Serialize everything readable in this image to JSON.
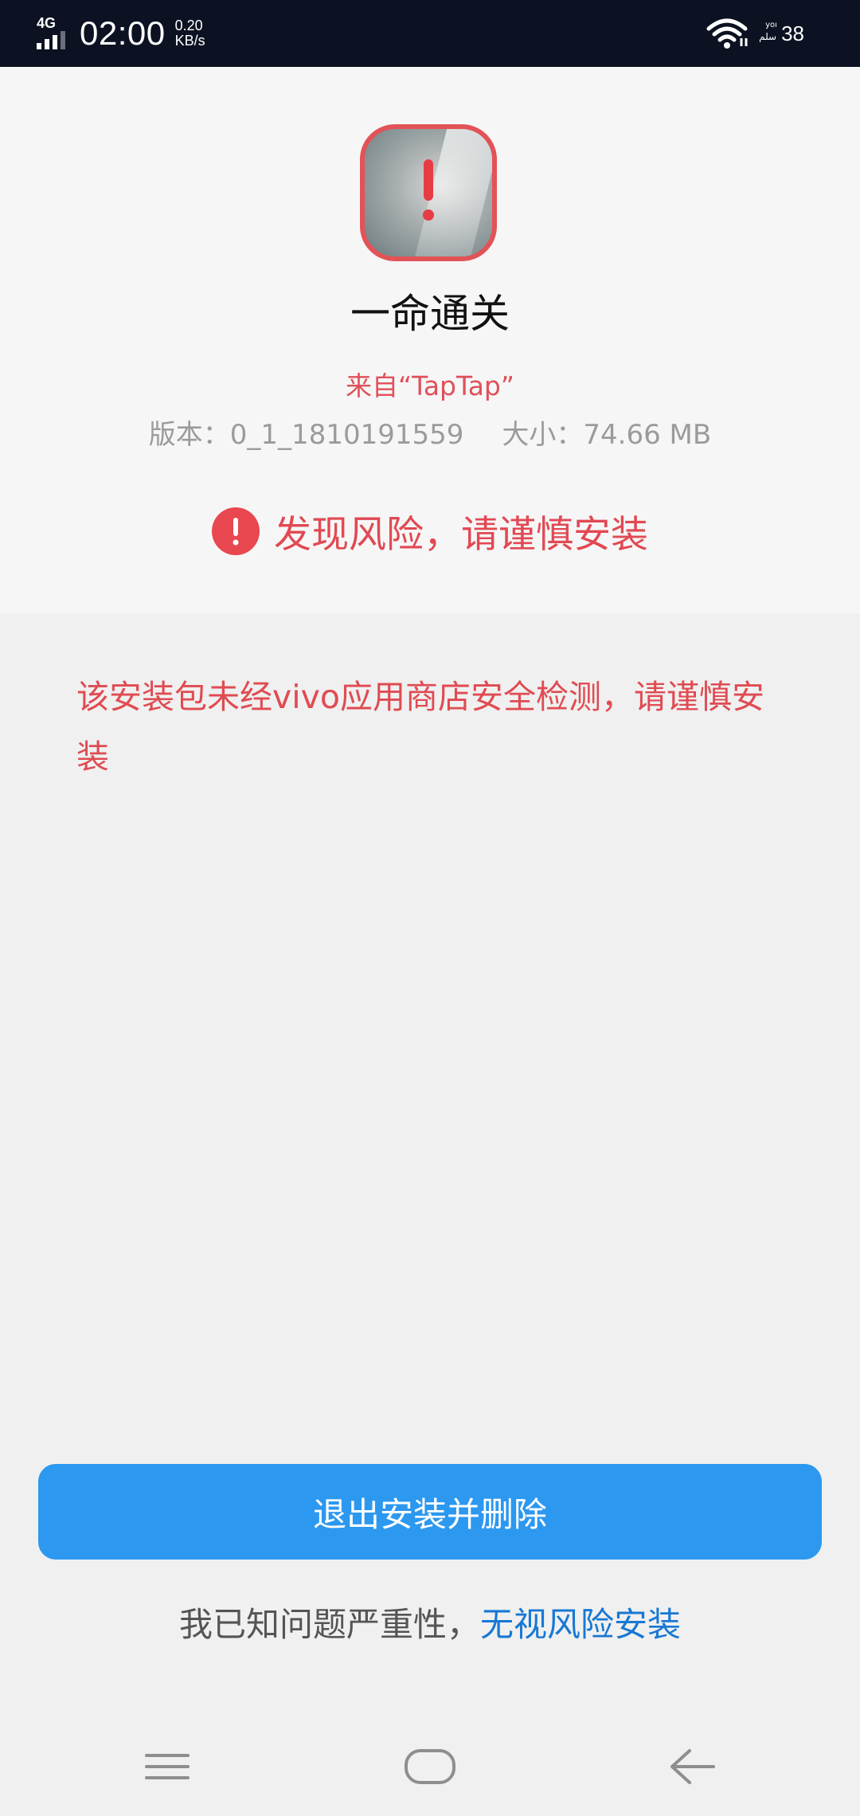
{
  "status_bar": {
    "network_type": "4G",
    "time": "02:00",
    "speed_value": "0.20",
    "speed_unit": "KB/s",
    "system_glyph_top": "yoı",
    "system_glyph_bottom": "سلم",
    "battery": "38",
    "icons": [
      "signal-icon",
      "wifi-icon"
    ]
  },
  "app": {
    "name": "一命通关",
    "source": "来自“TapTap”",
    "version": "版本：0_1_1810191559",
    "size": "大小：74.66 MB",
    "icon_name": "app-icon-warning"
  },
  "risk": {
    "title": "发现风险，请谨慎安装",
    "icon": "exclamation-circle-icon",
    "message": "该安装包未经vivo应用商店安全检测，请谨慎安装"
  },
  "actions": {
    "exit_label": "退出安装并删除",
    "acknowledge_prefix": "我已知问题严重性，",
    "ignore_label": "无视风险安装"
  },
  "nav": {
    "icons": [
      "menu-icon",
      "home-icon",
      "back-icon"
    ]
  },
  "colors": {
    "status_bar_bg": "#0c1222",
    "danger_red": "#e14953",
    "primary_blue": "#2c98f0",
    "link_blue": "#1778d4"
  }
}
